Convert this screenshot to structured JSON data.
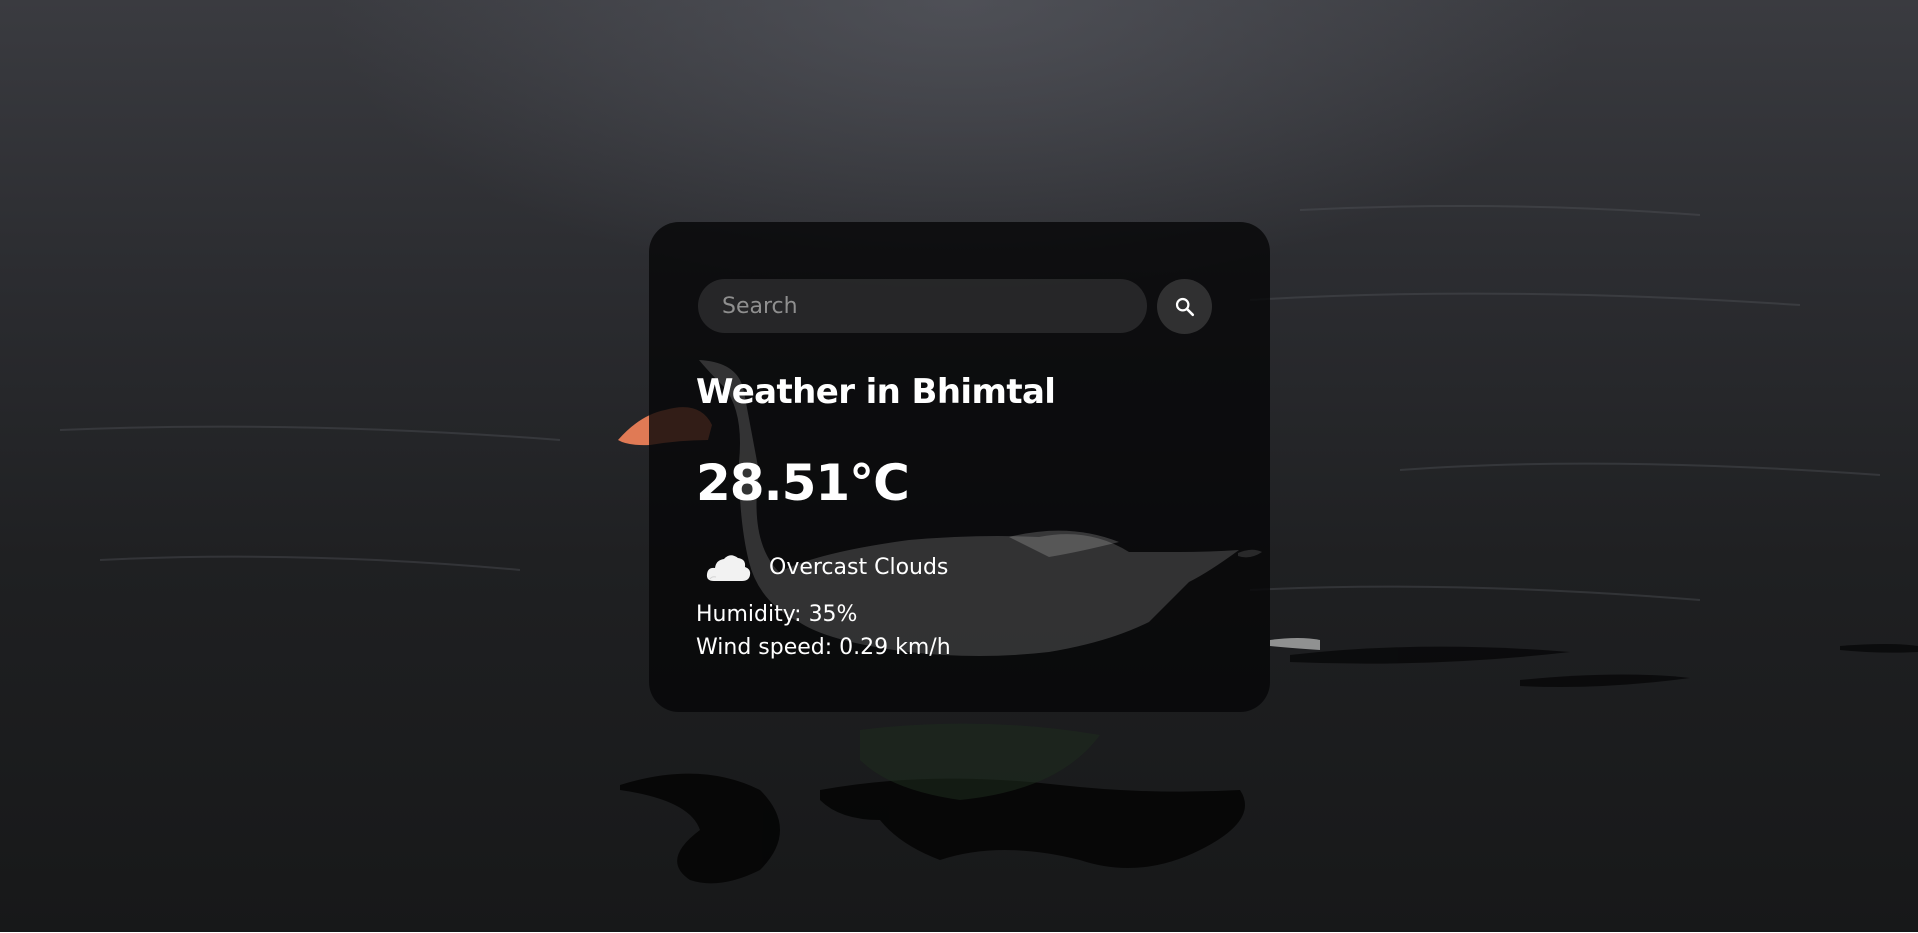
{
  "search": {
    "placeholder": "Search",
    "value": ""
  },
  "weather": {
    "title": "Weather in Bhimtal",
    "temperature": "28.51°C",
    "condition_icon": "cloud-icon",
    "condition": "Overcast Clouds",
    "humidity_label": "Humidity:",
    "humidity_value": "35%",
    "wind_label": "Wind speed:",
    "wind_value": "0.29 km/h"
  },
  "colors": {
    "card_background": "#060607",
    "text": "#ffffff",
    "input_background": "#3c3c3e"
  }
}
